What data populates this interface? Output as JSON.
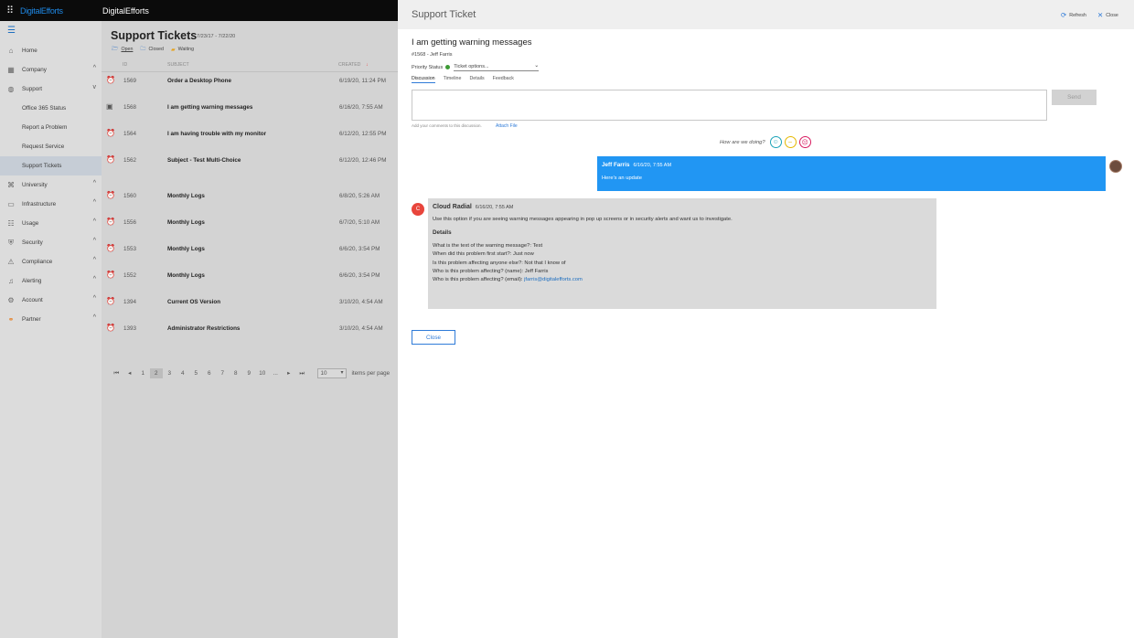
{
  "app": {
    "brand": "DigitalEfforts",
    "tenant": "DigitalEfforts"
  },
  "sidebar": {
    "items": [
      {
        "label": "Home",
        "icon": "home-icon"
      },
      {
        "label": "Company",
        "icon": "building-icon",
        "chevron": "^"
      },
      {
        "label": "Support",
        "icon": "globe-icon",
        "chevron": "v"
      },
      {
        "label": "University",
        "icon": "graduation-icon",
        "chevron": "^"
      },
      {
        "label": "Infrastructure",
        "icon": "monitor-icon",
        "chevron": "^"
      },
      {
        "label": "Usage",
        "icon": "usage-icon",
        "chevron": "^"
      },
      {
        "label": "Security",
        "icon": "shield-icon",
        "chevron": "^"
      },
      {
        "label": "Compliance",
        "icon": "warning-icon",
        "chevron": "^"
      },
      {
        "label": "Alerting",
        "icon": "bell-icon",
        "chevron": "^"
      },
      {
        "label": "Account",
        "icon": "gear-icon",
        "chevron": "^"
      },
      {
        "label": "Partner",
        "icon": "partner-icon",
        "chevron": "^"
      }
    ],
    "support_sub": [
      "Office 365 Status",
      "Report a Problem",
      "Request Service",
      "Support Tickets"
    ]
  },
  "list": {
    "title": "Support Tickets",
    "date_range": "7/23/17 - 7/22/20",
    "filters": [
      "Open",
      "Closed",
      "Waiting"
    ],
    "headers": {
      "id": "ID",
      "subject": "SUBJECT",
      "created": "CREATED",
      "sort": "↓"
    },
    "rows": [
      {
        "id": "1569",
        "subject": "Order a Desktop Phone",
        "created": "6/19/20, 11:24 PM"
      },
      {
        "id": "1568",
        "subject": "I am getting warning messages",
        "created": "6/16/20, 7:55 AM"
      },
      {
        "id": "1564",
        "subject": "I am having trouble with my monitor",
        "created": "6/12/20, 12:55 PM"
      },
      {
        "id": "1562",
        "subject": "Subject - Test Multi-Choice",
        "created": "6/12/20, 12:46 PM"
      },
      {
        "id": "1560",
        "subject": "Monthly Logs",
        "created": "6/8/20, 5:26 AM"
      },
      {
        "id": "1556",
        "subject": "Monthly Logs",
        "created": "6/7/20, 5:10 AM"
      },
      {
        "id": "1553",
        "subject": "Monthly Logs",
        "created": "6/6/20, 3:54 PM"
      },
      {
        "id": "1552",
        "subject": "Monthly Logs",
        "created": "6/6/20, 3:54 PM"
      },
      {
        "id": "1394",
        "subject": "Current OS Version",
        "created": "3/10/20, 4:54 AM"
      },
      {
        "id": "1393",
        "subject": "Administrator Restrictions",
        "created": "3/10/20, 4:54 AM"
      }
    ],
    "pager": {
      "first": "⏮",
      "prev": "◂",
      "next": "▸",
      "last": "⏭",
      "pages": [
        "1",
        "2",
        "3",
        "4",
        "5",
        "6",
        "7",
        "8",
        "9",
        "10",
        "..."
      ],
      "current": "2",
      "per_page": "10",
      "per_page_label": "items per page"
    }
  },
  "panel": {
    "title": "Support Ticket",
    "refresh": "Refresh",
    "close": "Close",
    "ticket_title": "I am getting warning messages",
    "ticket_sub": "#1568 - Jeff Farris",
    "priority_label": "Priority Status",
    "ticket_options": "Ticket options...",
    "tabs": [
      "Discussion",
      "Timeline",
      "Details",
      "Feedback"
    ],
    "send": "Send",
    "hint": "Add your comments to this discussion.",
    "attach": "Attach File",
    "feedback_q": "How are we doing?",
    "msg_me": {
      "name": "Jeff Farris",
      "time": "6/16/20, 7:55 AM",
      "text": "Here's an update"
    },
    "msg_cr": {
      "avatar": "C",
      "name": "Cloud Radial",
      "time": "6/16/20, 7:55 AM",
      "intro": "Use this option if you are seeing warning messages appearing in pop up screens or in security alerts and want us to investigate.",
      "details_heading": "Details",
      "lines": [
        "What is the text of the warning message?: Test",
        "When did this problem first start?: Just now",
        "Is this problem affecting anyone else?: Not that I know of",
        "Who is this problem affecting? (name): Jeff Farris"
      ],
      "email_label": "Who is this problem affecting? (email): ",
      "email": "jfarris@digitalefforts.com"
    },
    "close_button": "Close"
  },
  "colors": {
    "accent": "#2f7bd8",
    "bubble": "#2196f3",
    "cr_avatar": "#e8453c",
    "good": "#1aa3b8",
    "neutral": "#e6b800",
    "bad": "#d81b60"
  }
}
